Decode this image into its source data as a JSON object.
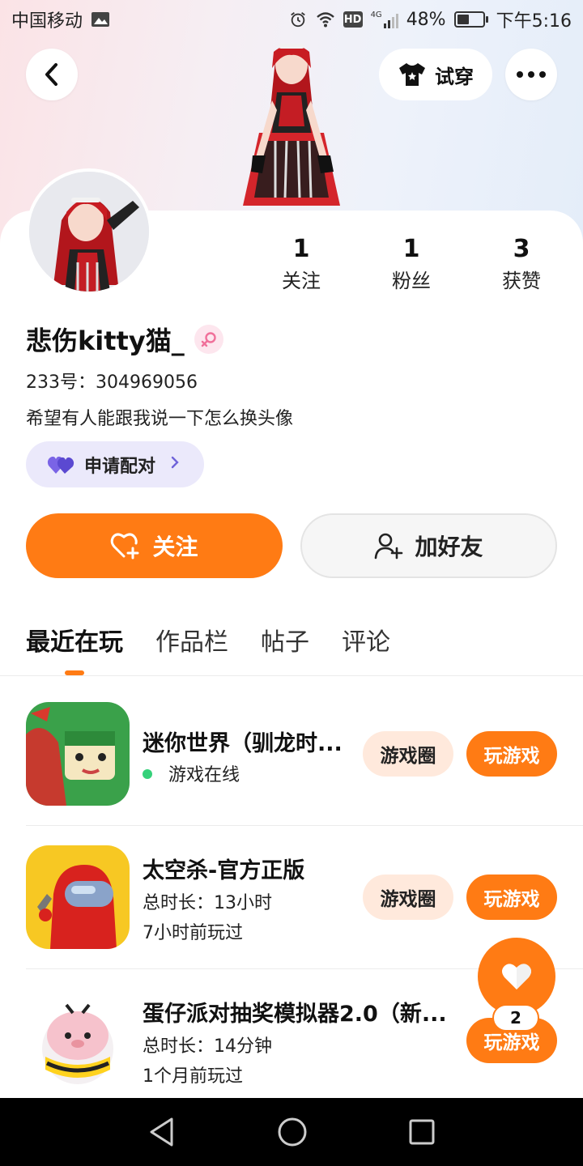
{
  "status_bar": {
    "carrier": "中国移动",
    "network": "4G",
    "hd": "HD",
    "battery": "48%",
    "battery_level": 0.48,
    "time": "下午5:16"
  },
  "header": {
    "try_on_label": "试穿"
  },
  "profile": {
    "stats": [
      {
        "value": "1",
        "label": "关注"
      },
      {
        "value": "1",
        "label": "粉丝"
      },
      {
        "value": "3",
        "label": "获赞"
      }
    ],
    "nickname": "悲伤kitty猫_",
    "uid": "233号：304969056",
    "bio": "希望有人能跟我说一下怎么换头像",
    "pair_label": "申请配对"
  },
  "actions": {
    "follow_label": "关注",
    "add_friend_label": "加好友"
  },
  "tabs": [
    {
      "label": "最近在玩",
      "active": true
    },
    {
      "label": "作品栏",
      "active": false
    },
    {
      "label": "帖子",
      "active": false
    },
    {
      "label": "评论",
      "active": false
    }
  ],
  "games": [
    {
      "title": "迷你世界（驯龙时...",
      "line1": "游戏在线",
      "line2": "",
      "online": true,
      "circle_label": "游戏圈",
      "play_label": "玩游戏"
    },
    {
      "title": "太空杀-官方正版",
      "line1": "总时长：13小时",
      "line2": "7小时前玩过",
      "online": false,
      "circle_label": "游戏圈",
      "play_label": "玩游戏"
    },
    {
      "title": "蛋仔派对抽奖模拟器2.0（新...",
      "line1": "总时长：14分钟",
      "line2": "1个月前玩过",
      "online": false,
      "circle_label": "",
      "play_label": "玩游戏"
    }
  ],
  "fab": {
    "badge": "2"
  },
  "colors": {
    "accent": "#ff7b14",
    "online": "#35d17a",
    "pair_bg": "#ebe9fb"
  }
}
